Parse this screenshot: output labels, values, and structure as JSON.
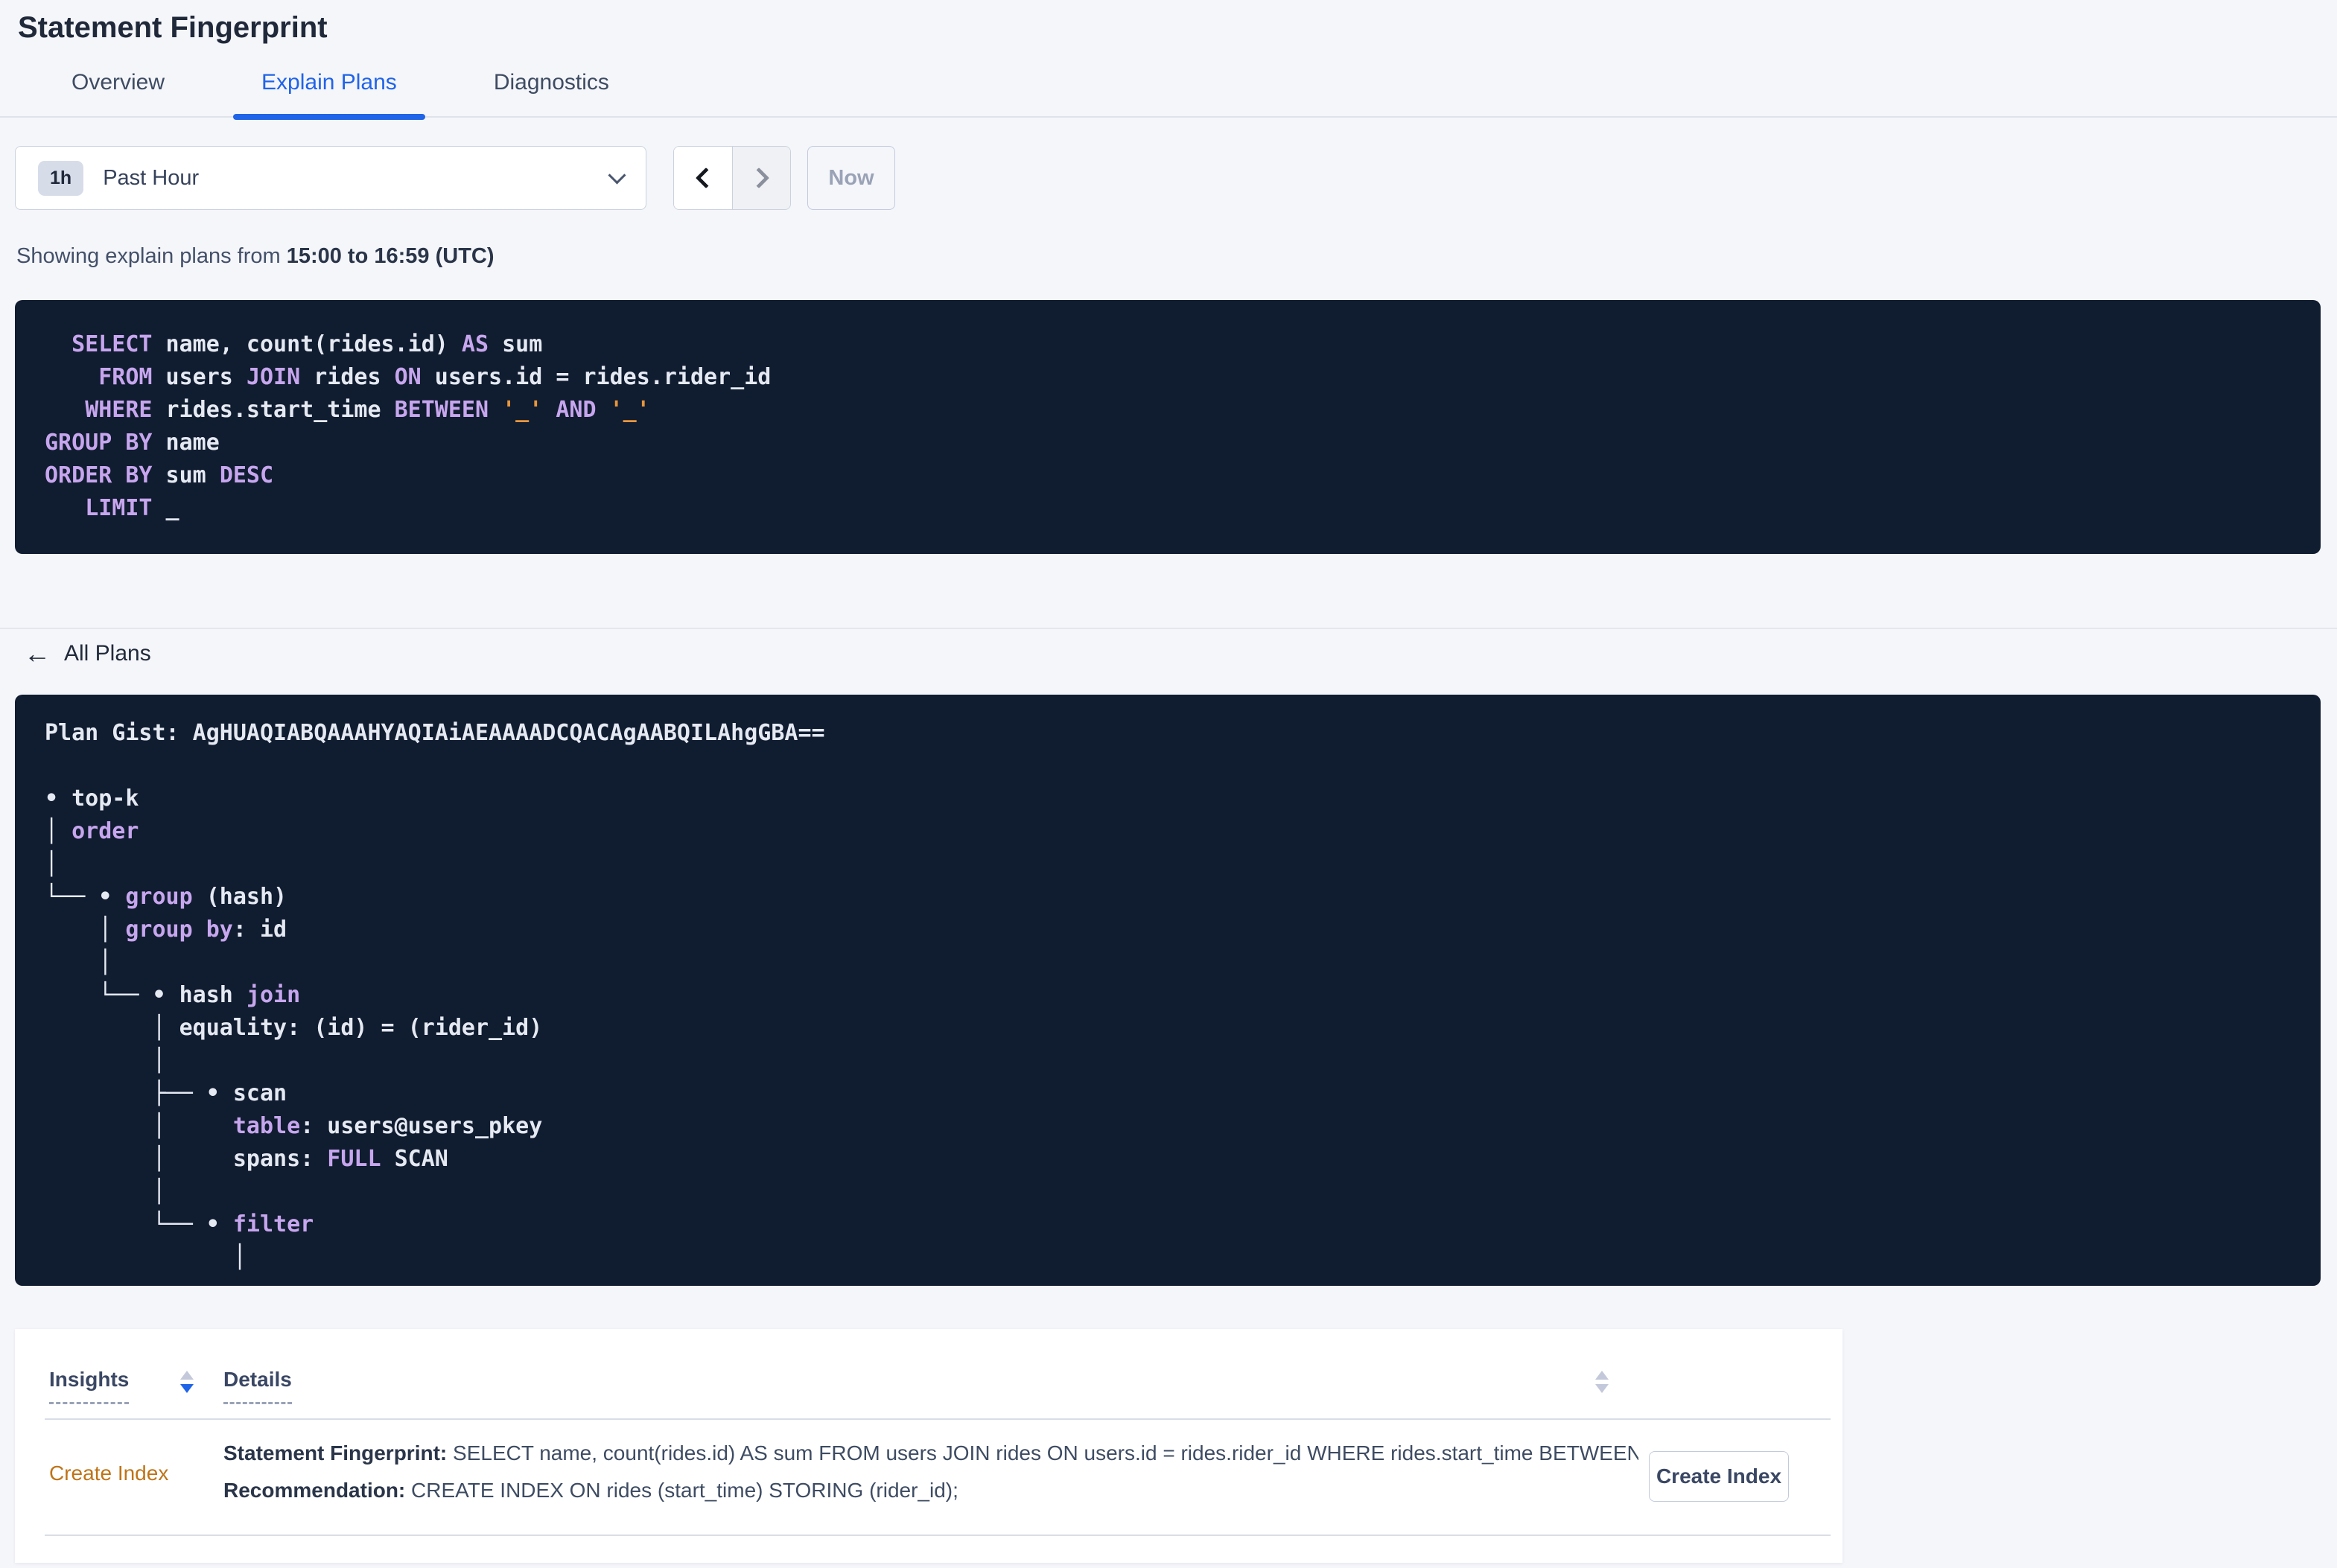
{
  "page": {
    "title": "Statement Fingerprint"
  },
  "tabs": [
    {
      "label": "Overview"
    },
    {
      "label": "Explain Plans"
    },
    {
      "label": "Diagnostics"
    }
  ],
  "time_selector": {
    "badge": "1h",
    "label": "Past Hour",
    "now_label": "Now",
    "icons": [
      "chevron-down-icon",
      "chevron-left-icon",
      "chevron-right-icon"
    ]
  },
  "showing": {
    "prefix": "Showing explain plans from ",
    "range": "15:00 to 16:59 (UTC)"
  },
  "sql": {
    "lines": [
      [
        {
          "t": "  ",
          "c": "txt"
        },
        {
          "t": "SELECT",
          "c": "kw"
        },
        {
          "t": " name, count(rides.id) ",
          "c": "txt"
        },
        {
          "t": "AS",
          "c": "kw"
        },
        {
          "t": " sum",
          "c": "txt"
        }
      ],
      [
        {
          "t": "    ",
          "c": "txt"
        },
        {
          "t": "FROM",
          "c": "kw"
        },
        {
          "t": " users ",
          "c": "txt"
        },
        {
          "t": "JOIN",
          "c": "kw"
        },
        {
          "t": " rides ",
          "c": "txt"
        },
        {
          "t": "ON",
          "c": "kw"
        },
        {
          "t": " users.id = rides.rider_id",
          "c": "txt"
        }
      ],
      [
        {
          "t": "   ",
          "c": "txt"
        },
        {
          "t": "WHERE",
          "c": "kw"
        },
        {
          "t": " rides.start_time ",
          "c": "txt"
        },
        {
          "t": "BETWEEN",
          "c": "kw"
        },
        {
          "t": " ",
          "c": "txt"
        },
        {
          "t": "'_'",
          "c": "param"
        },
        {
          "t": " ",
          "c": "txt"
        },
        {
          "t": "AND",
          "c": "kw"
        },
        {
          "t": " ",
          "c": "txt"
        },
        {
          "t": "'_'",
          "c": "param"
        }
      ],
      [
        {
          "t": "GROUP BY",
          "c": "kw"
        },
        {
          "t": " name",
          "c": "txt"
        }
      ],
      [
        {
          "t": "ORDER BY",
          "c": "kw"
        },
        {
          "t": " sum ",
          "c": "txt"
        },
        {
          "t": "DESC",
          "c": "kw"
        }
      ],
      [
        {
          "t": "   ",
          "c": "txt"
        },
        {
          "t": "LIMIT",
          "c": "kw"
        },
        {
          "t": " _",
          "c": "txt"
        }
      ]
    ]
  },
  "all_plans": {
    "label": "All Plans",
    "icon": "arrow-left-icon"
  },
  "plan": {
    "gist": "AgHUAQIABQAAAHYAQIAiAEAAAADCQACAgAABQILAhgGBA==",
    "lines": [
      [
        {
          "t": "Plan Gist: AgHUAQIABQAAAHYAQIAiAEAAAADCQACAgAABQILAhgGBA==",
          "c": "txt"
        }
      ],
      [],
      [
        {
          "t": "• top-k",
          "c": "txt"
        }
      ],
      [
        {
          "t": "│ ",
          "c": "txt"
        },
        {
          "t": "order",
          "c": "kw"
        }
      ],
      [
        {
          "t": "│",
          "c": "txt"
        }
      ],
      [
        {
          "t": "└── • ",
          "c": "txt"
        },
        {
          "t": "group",
          "c": "kw"
        },
        {
          "t": " (hash)",
          "c": "txt"
        }
      ],
      [
        {
          "t": "    │ ",
          "c": "txt"
        },
        {
          "t": "group by",
          "c": "kw"
        },
        {
          "t": ": id",
          "c": "txt"
        }
      ],
      [
        {
          "t": "    │",
          "c": "txt"
        }
      ],
      [
        {
          "t": "    └── • hash ",
          "c": "txt"
        },
        {
          "t": "join",
          "c": "kw"
        }
      ],
      [
        {
          "t": "        │ equality: (id) = (rider_id)",
          "c": "txt"
        }
      ],
      [
        {
          "t": "        │",
          "c": "txt"
        }
      ],
      [
        {
          "t": "        ├── • scan",
          "c": "txt"
        }
      ],
      [
        {
          "t": "        │     ",
          "c": "txt"
        },
        {
          "t": "table",
          "c": "kw"
        },
        {
          "t": ": users@users_pkey",
          "c": "txt"
        }
      ],
      [
        {
          "t": "        │     spans: ",
          "c": "txt"
        },
        {
          "t": "FULL",
          "c": "kw"
        },
        {
          "t": " SCAN",
          "c": "txt"
        }
      ],
      [
        {
          "t": "        │",
          "c": "txt"
        }
      ],
      [
        {
          "t": "        └── • ",
          "c": "txt"
        },
        {
          "t": "filter",
          "c": "kw"
        }
      ],
      [
        {
          "t": "              │",
          "c": "txt"
        }
      ]
    ]
  },
  "insights_table": {
    "columns": [
      {
        "label": "Insights"
      },
      {
        "label": "Details"
      }
    ],
    "sort": {
      "sorted_column": "Insights",
      "direction": "desc"
    },
    "row": {
      "insight": "Create Index",
      "fingerprint_label": "Statement Fingerprint:",
      "fingerprint_text": " SELECT name, count(rides.id) AS sum FROM users JOIN rides ON users.id = rides.rider_id WHERE rides.start_time BETWEEN '_…",
      "recommendation_label": "Recommendation:",
      "recommendation_text": " CREATE INDEX ON rides (start_time) STORING (rider_id);",
      "button_label": "Create Index"
    }
  },
  "colors": {
    "accent": "#2064E8",
    "page-bg": "#F5F6FA",
    "code-bg": "#101C30",
    "code-text": "#E5E9F2",
    "code-keyword": "#C7A6EE",
    "code-param": "#E8963C",
    "insight-link": "#BF7317",
    "text-dark": "#20293A",
    "text-body": "#3E4C63",
    "border": "#C9D2DF",
    "disabled-text": "#9AA3B6"
  }
}
